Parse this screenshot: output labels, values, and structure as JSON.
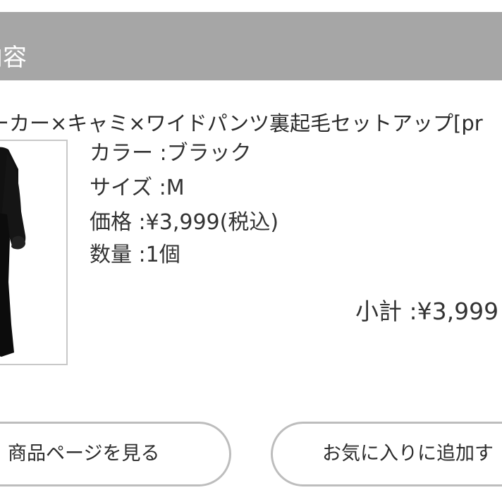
{
  "header": {
    "title": "内容"
  },
  "product": {
    "name": "ーカー×キャミ×ワイドパンツ裏起毛セットアップ[pr",
    "image_icon": "product-photo-black-outfit",
    "color": "カラー :ブラック",
    "size": "サイズ :M",
    "price": "価格 :¥3,999(税込)",
    "quantity": "数量 :1個"
  },
  "subtotal": "小計 :¥3,999",
  "buttons": {
    "product_page": "商品ページを見る",
    "add_favorite": "お気に入りに追加す"
  },
  "colors": {
    "header_background": "#a6a6a6",
    "header_text": "#ffffff",
    "button_border": "#bdbdbd",
    "text": "#333333"
  }
}
